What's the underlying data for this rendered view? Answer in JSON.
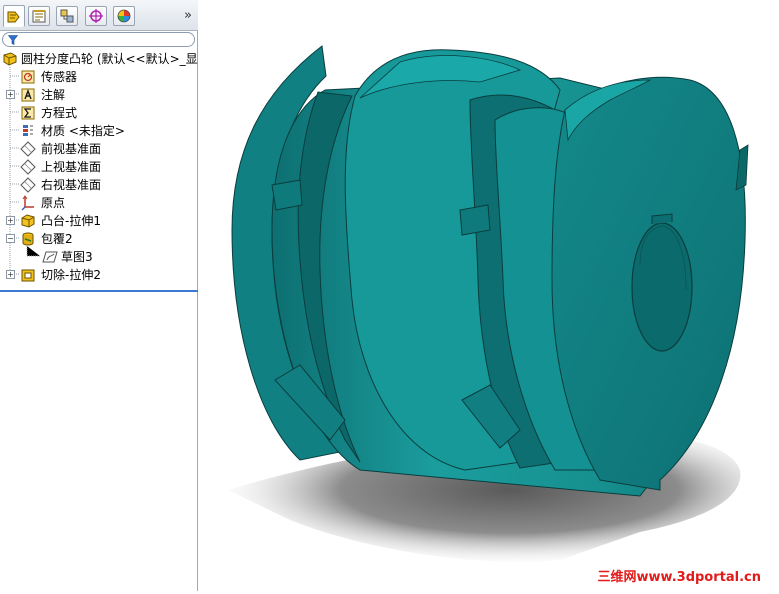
{
  "tabs": [
    {
      "icon": "feature-manager-icon"
    },
    {
      "icon": "property-manager-icon"
    },
    {
      "icon": "configuration-manager-icon"
    },
    {
      "icon": "dimxpert-icon"
    },
    {
      "icon": "display-manager-icon"
    }
  ],
  "tabs_more": "»",
  "tree": {
    "root": "圆柱分度凸轮 (默认<<默认>_显",
    "items": [
      {
        "label": "传感器",
        "icon": "sensor-icon"
      },
      {
        "label": "注解",
        "icon": "annotation-icon"
      },
      {
        "label": "方程式",
        "icon": "equation-icon"
      },
      {
        "label": "材质 <未指定>",
        "icon": "material-icon"
      },
      {
        "label": "前视基准面",
        "icon": "plane-icon"
      },
      {
        "label": "上视基准面",
        "icon": "plane-icon"
      },
      {
        "label": "右视基准面",
        "icon": "plane-icon"
      },
      {
        "label": "原点",
        "icon": "origin-icon"
      },
      {
        "label": "凸台-拉伸1",
        "icon": "boss-extrude-icon"
      },
      {
        "label": "包覆2",
        "icon": "wrap-icon"
      },
      {
        "label": "草图3",
        "icon": "sketch-icon"
      },
      {
        "label": "切除-拉伸2",
        "icon": "cut-extrude-icon"
      }
    ]
  },
  "model": {
    "color": "#13888a",
    "dark": "#0c6b6d",
    "light": "#1ea3a3"
  },
  "watermark": "三维网www.3dportal.cn"
}
